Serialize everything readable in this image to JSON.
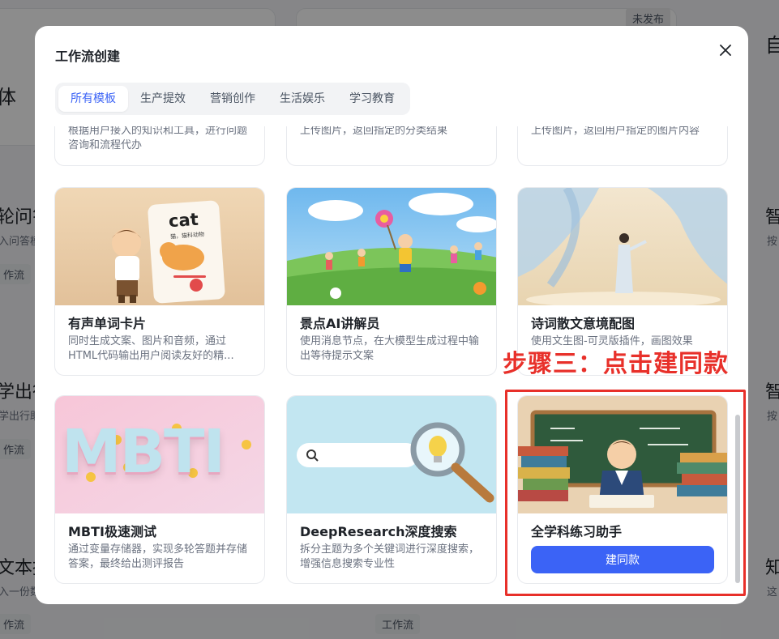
{
  "background": {
    "status_badge": "未发布",
    "heading_left": "体",
    "heading_right": "自",
    "items_left": [
      {
        "title": "轮问答",
        "sub": "入问答模",
        "tag": "作流"
      },
      {
        "title": "学出行",
        "sub": "学出行助",
        "tag": "作流"
      },
      {
        "title": "文本报",
        "sub": "入一份数",
        "tag": "作流"
      }
    ],
    "items_right": [
      {
        "title": "智",
        "sub": "按"
      },
      {
        "title": "智",
        "sub": "按"
      },
      {
        "title": "知",
        "sub": "这"
      }
    ],
    "bottom_tag": "工作流"
  },
  "modal": {
    "title": "工作流创建",
    "tabs": [
      "所有模板",
      "生产提效",
      "营销创作",
      "生活娱乐",
      "学习教育"
    ],
    "active_tab": 0,
    "top_row_desc": [
      "根据用户接入的知识和工具，进行问题咨询和流程代办",
      "上传图片，返回指定的分类结果",
      "上传图片，返回用户指定的图片内容"
    ],
    "templates": [
      {
        "title": "有声单词卡片",
        "desc": "同时生成文案、图片和音频，通过HTML代码输出用户阅读友好的精...",
        "image": "cat-word-card-illustration",
        "image_text": "cat",
        "image_subtext": "猫，猫科动物"
      },
      {
        "title": "景点AI讲解员",
        "desc": "使用消息节点，在大模型生成过程中输出等待提示文案",
        "image": "kids-running-meadow-illustration"
      },
      {
        "title": "诗词散文意境配图",
        "desc": "使用文生图-可灵版插件，画图效果",
        "image": "ancient-scholar-curtains-illustration"
      },
      {
        "title": "MBTI极速测试",
        "desc": "通过变量存储器，实现多轮答题并存储答案，最终给出测评报告",
        "image": "mbti-letters-illustration",
        "image_text": "MBTI"
      },
      {
        "title": "DeepResearch深度搜索",
        "desc": "拆分主题为多个关键词进行深度搜索，增强信息搜索专业性",
        "image": "search-magnifier-illustration"
      },
      {
        "title": "全学科练习助手",
        "desc": "",
        "image": "student-books-blackboard-illustration",
        "button": "建同款"
      }
    ]
  },
  "annotation": {
    "text": "步骤三：点击建同款",
    "color": "#e8302a"
  },
  "colors": {
    "accent": "#3b63f6",
    "annotation": "#e8302a"
  }
}
